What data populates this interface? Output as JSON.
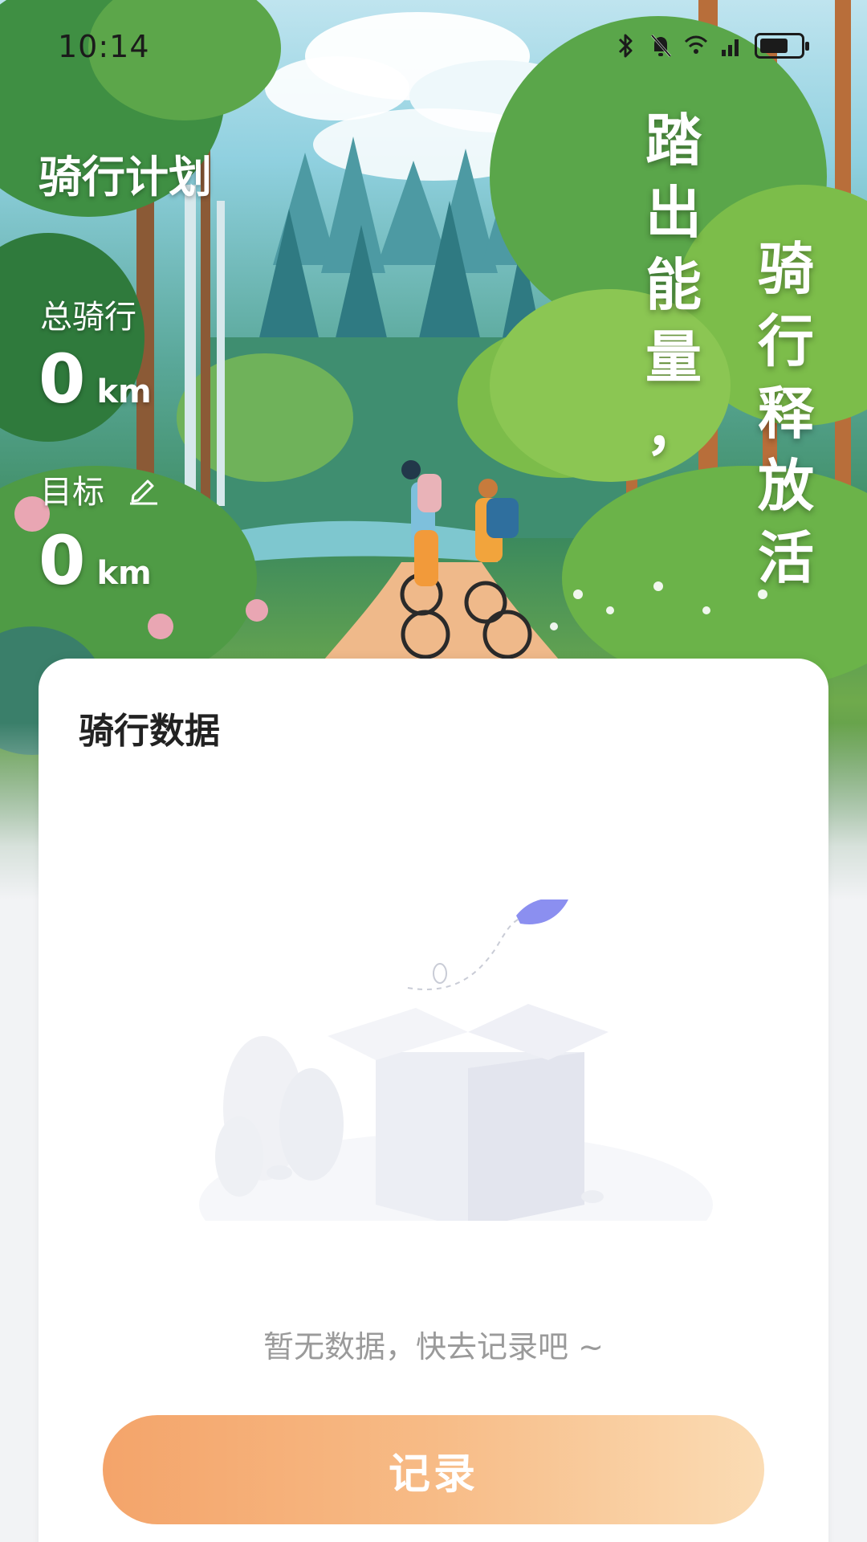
{
  "status_bar": {
    "time": "10:14",
    "icons": [
      "bluetooth-icon",
      "bell-mute-icon",
      "wifi-icon",
      "signal-icon",
      "battery-icon"
    ],
    "battery_level": 0.7
  },
  "header": {
    "title": "骑行计划",
    "total_label": "总骑行",
    "total_value": "0",
    "total_unit": "km",
    "goal_label": "目标",
    "goal_value": "0",
    "goal_unit": "km"
  },
  "slogan": {
    "column_right": "骑行释放活",
    "column_left": "踏出能量，"
  },
  "card": {
    "title": "骑行数据",
    "empty_text": "暂无数据，快去记录吧 ~",
    "record_button": "记录"
  },
  "colors": {
    "button_gradient_start": "#f4a46a",
    "button_gradient_end": "#fbdcb4",
    "background": "#f2f3f5",
    "empty_text": "#9a9a9a"
  }
}
